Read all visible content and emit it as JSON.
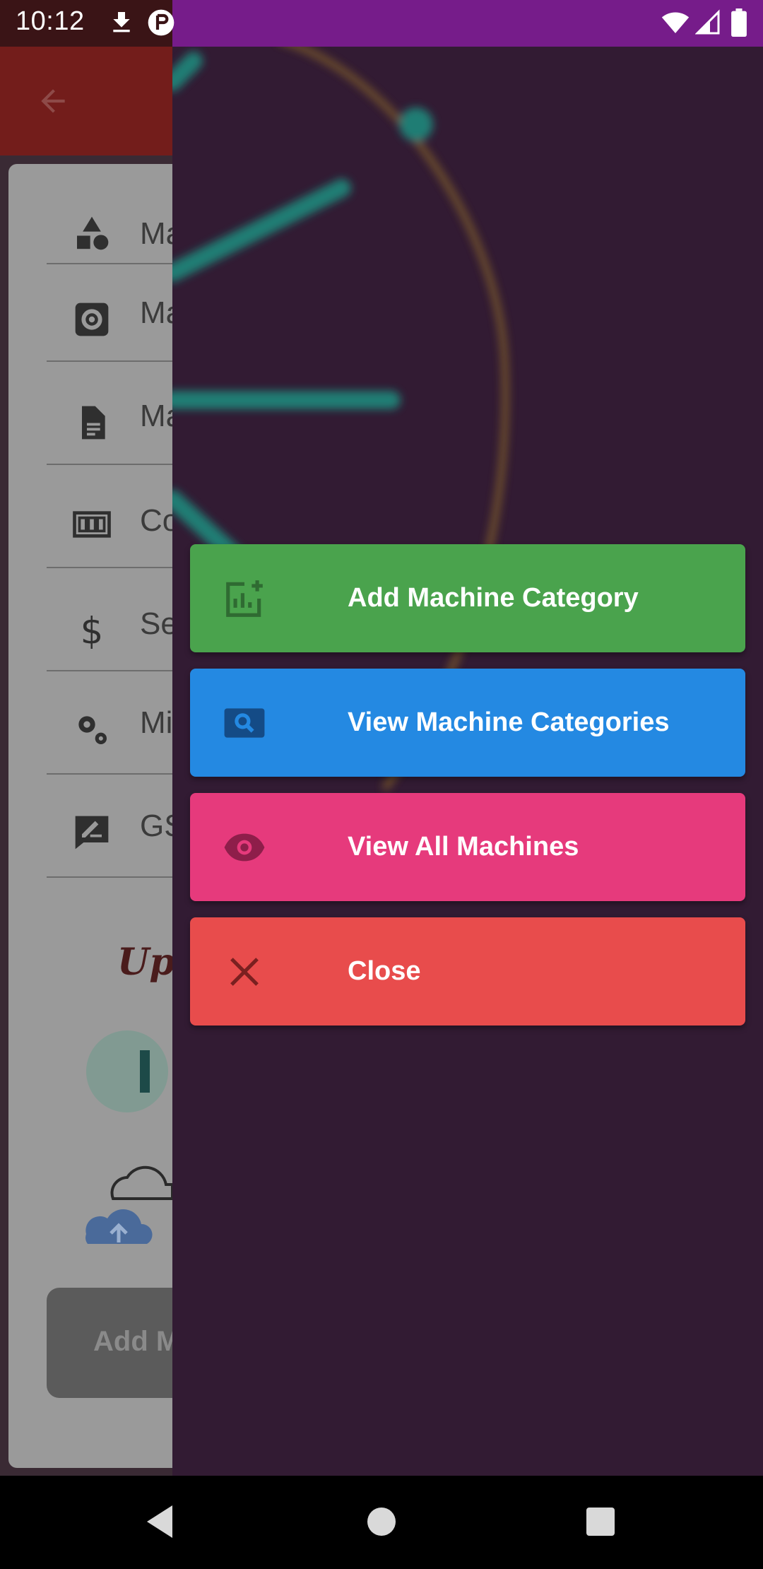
{
  "status_bar": {
    "time": "10:12",
    "icons": [
      "download-icon",
      "app-notification-icon",
      "wifi-icon",
      "signal-icon",
      "battery-icon"
    ],
    "left_bg": "#3a1416",
    "right_bg": "#761c8a"
  },
  "background_app": {
    "toolbar_color": "#731d1b",
    "menu_items": [
      {
        "icon": "shapes-icon",
        "label": "Ma"
      },
      {
        "icon": "settings-box-icon",
        "label": "Ma"
      },
      {
        "icon": "document-icon",
        "label": "Ma"
      },
      {
        "icon": "counter-icon",
        "label": "Co"
      },
      {
        "icon": "dollar-icon",
        "label": "Se"
      },
      {
        "icon": "gears-icon",
        "label": "Mi"
      },
      {
        "icon": "signature-icon",
        "label": "GS"
      }
    ],
    "upload_title": "Uplo",
    "add_button_label": "Add M"
  },
  "dialog": {
    "background": "#321b33",
    "actions": [
      {
        "label": "Add Machine Category",
        "icon": "add-chart-icon",
        "color": "#4aa34d"
      },
      {
        "label": "View Machine Categories",
        "icon": "search-image-icon",
        "color": "#2489e2"
      },
      {
        "label": "View All Machines",
        "icon": "eye-icon",
        "color": "#e63a7c"
      },
      {
        "label": "Close",
        "icon": "close-icon",
        "color": "#e84c4c"
      }
    ]
  },
  "nav_bar": {
    "buttons": [
      "back-icon",
      "home-icon",
      "recents-icon"
    ]
  }
}
